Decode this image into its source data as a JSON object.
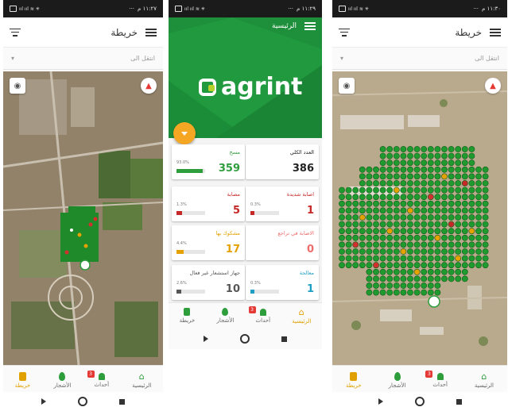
{
  "status": {
    "left_time": "١١:٢٧ م",
    "mid_time": "١١:٢٩ م",
    "right_time": "١١:٣٠ م"
  },
  "map_screen": {
    "title": "خريطة",
    "goto_placeholder": "انتقل الى"
  },
  "home_screen": {
    "title": "الرئيسية",
    "logo_text": "agrint"
  },
  "cards": [
    {
      "label": "العدد الكلي",
      "value": "386",
      "color": "#222222",
      "pct": "",
      "fill": 0
    },
    {
      "label": "مسح",
      "value": "359",
      "color": "#2e9d3c",
      "pct": "93.0%",
      "fill": 0.93
    },
    {
      "label": "اصابة شديدة",
      "value": "1",
      "color": "#c62828",
      "pct": "0.3%",
      "fill": 0.1
    },
    {
      "label": "مصابة",
      "value": "5",
      "color": "#c62828",
      "pct": "1.3%",
      "fill": 0.2
    },
    {
      "label": "الاصابة في تراجع",
      "value": "0",
      "color": "#ef6c6c",
      "pct": "",
      "fill": 0
    },
    {
      "label": "مشكوك بها",
      "value": "17",
      "color": "#e5a100",
      "pct": "4.4%",
      "fill": 0.25
    },
    {
      "label": "معالجة",
      "value": "1",
      "color": "#1e9ec4",
      "pct": "0.3%",
      "fill": 0.1
    },
    {
      "label": "جهاز استشعار غير فعال",
      "value": "10",
      "color": "#555555",
      "pct": "2.6%",
      "fill": 0.18
    }
  ],
  "nav": {
    "home": "الرئيسية",
    "events": "أحداث",
    "events_badge": "3",
    "trees": "الأشجار",
    "map": "خريطة"
  },
  "colors": {
    "green": "#2e9d3c",
    "accent": "#e0a100",
    "brand": "#1e8f3a"
  }
}
